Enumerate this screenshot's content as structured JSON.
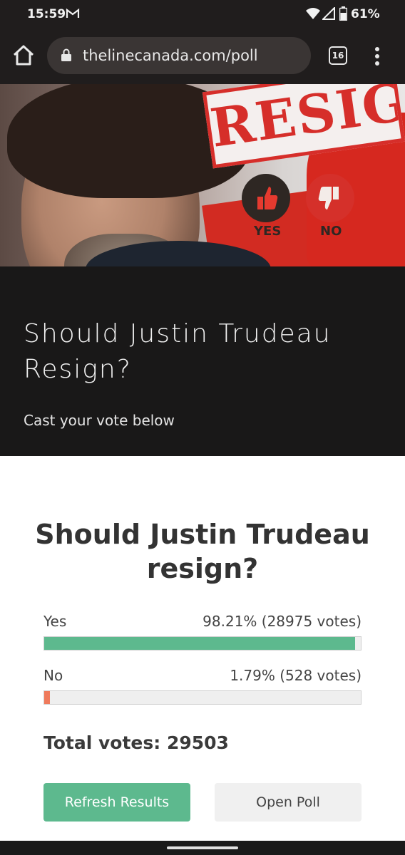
{
  "status_bar": {
    "time": "15:59",
    "battery": "61%",
    "icons": [
      "gmail-icon",
      "wifi-icon",
      "signal-icon",
      "battery-icon"
    ]
  },
  "browser": {
    "url": "thelinecanada.com/poll",
    "tab_count": "16",
    "icons": [
      "home-icon",
      "lock-icon",
      "tabs-icon",
      "more-vert-icon"
    ]
  },
  "hero_image": {
    "stamp_text": "RESIGN",
    "yes_label": "YES",
    "no_label": "NO"
  },
  "header": {
    "title": "Should Justin Trudeau Resign?",
    "subtitle": "Cast your vote below"
  },
  "poll": {
    "question": "Should Justin Trudeau resign?",
    "options": [
      {
        "label": "Yes",
        "result": "98.21% (28975 votes)",
        "percent": 98.21,
        "color": "#5db98e"
      },
      {
        "label": "No",
        "result": "1.79% (528 votes)",
        "percent": 1.79,
        "color": "#ef7a5c"
      }
    ],
    "total": "Total votes: 29503",
    "refresh_label": "Refresh Results",
    "open_label": "Open Poll"
  }
}
